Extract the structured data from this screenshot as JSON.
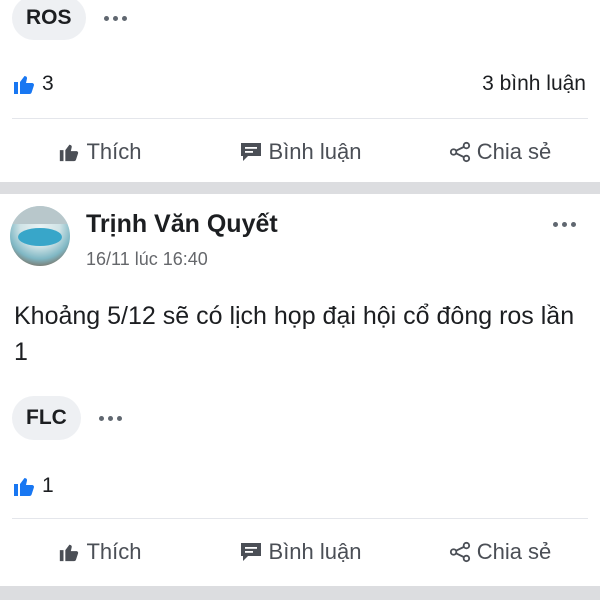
{
  "post1": {
    "tag": "ROS",
    "like_count": "3",
    "comment_count": "3 bình luận",
    "actions": {
      "like": "Thích",
      "comment": "Bình luận",
      "share": "Chia sẻ"
    }
  },
  "post2": {
    "author": "Trịnh Văn Quyết",
    "time": "16/11 lúc 16:40",
    "body": "Khoảng 5/12 sẽ có lịch họp đại hội cổ đông ros lần 1",
    "tag": "FLC",
    "like_count": "1",
    "actions": {
      "like": "Thích",
      "comment": "Bình luận",
      "share": "Chia sẻ"
    }
  },
  "icons": {
    "like_badge": "thumbs-up-blue-icon",
    "like": "thumbs-up-icon",
    "comment": "comment-bubble-icon",
    "share": "share-icon",
    "more": "more-horizontal-icon"
  },
  "colors": {
    "like_blue": "#1877f2",
    "action_gray": "#4b4f56",
    "band": "#dcdde0"
  }
}
